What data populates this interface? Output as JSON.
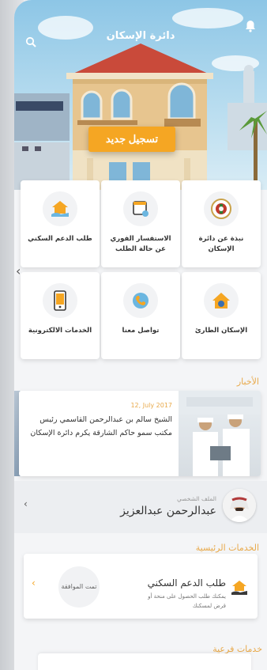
{
  "header": {
    "title": "دائرة الإسكان",
    "search_icon": "search-icon",
    "bell_icon": "bell-icon"
  },
  "hero": {
    "register_button": "تسجيل جديد"
  },
  "grid": {
    "tiles": [
      {
        "label": "نبذة عن دائرة الإسكان",
        "icon": "emblem-icon"
      },
      {
        "label": "الاستفسار الفوري عن حالة الطلب",
        "icon": "inquiry-window-icon"
      },
      {
        "label": "طلب الدعم السكني",
        "icon": "house-hand-icon"
      },
      {
        "label": "الإسكان الطارئ",
        "icon": "emergency-house-icon"
      },
      {
        "label": "تواصل معنا",
        "icon": "phone-icon"
      },
      {
        "label": "الخدمات الالكترونية",
        "icon": "mobile-icon"
      }
    ]
  },
  "news": {
    "section_title": "الأخبار",
    "date": "12, July 2017",
    "text": "الشيخ سالم بن عبدالرحمن القاسمي رئيس مكتب سمو حاكم الشارقة يكرم دائرة الإسكان"
  },
  "profile": {
    "label": "الملف الشخصي",
    "name": "عبدالرحمن عبدالعزيز"
  },
  "main_services": {
    "section_title": "الخدمات الرئيسية",
    "card": {
      "title": "طلب الدعم السكني",
      "description": "يمكنك طلب الحصول على منحة أو قرض لمسكنك",
      "status": "تمت الموافقة"
    }
  },
  "sub_services": {
    "section_title": "خدمات فرعية"
  },
  "colors": {
    "accent": "#f5a623",
    "section_title": "#e8a94a",
    "sky": "#8dc6e6"
  }
}
